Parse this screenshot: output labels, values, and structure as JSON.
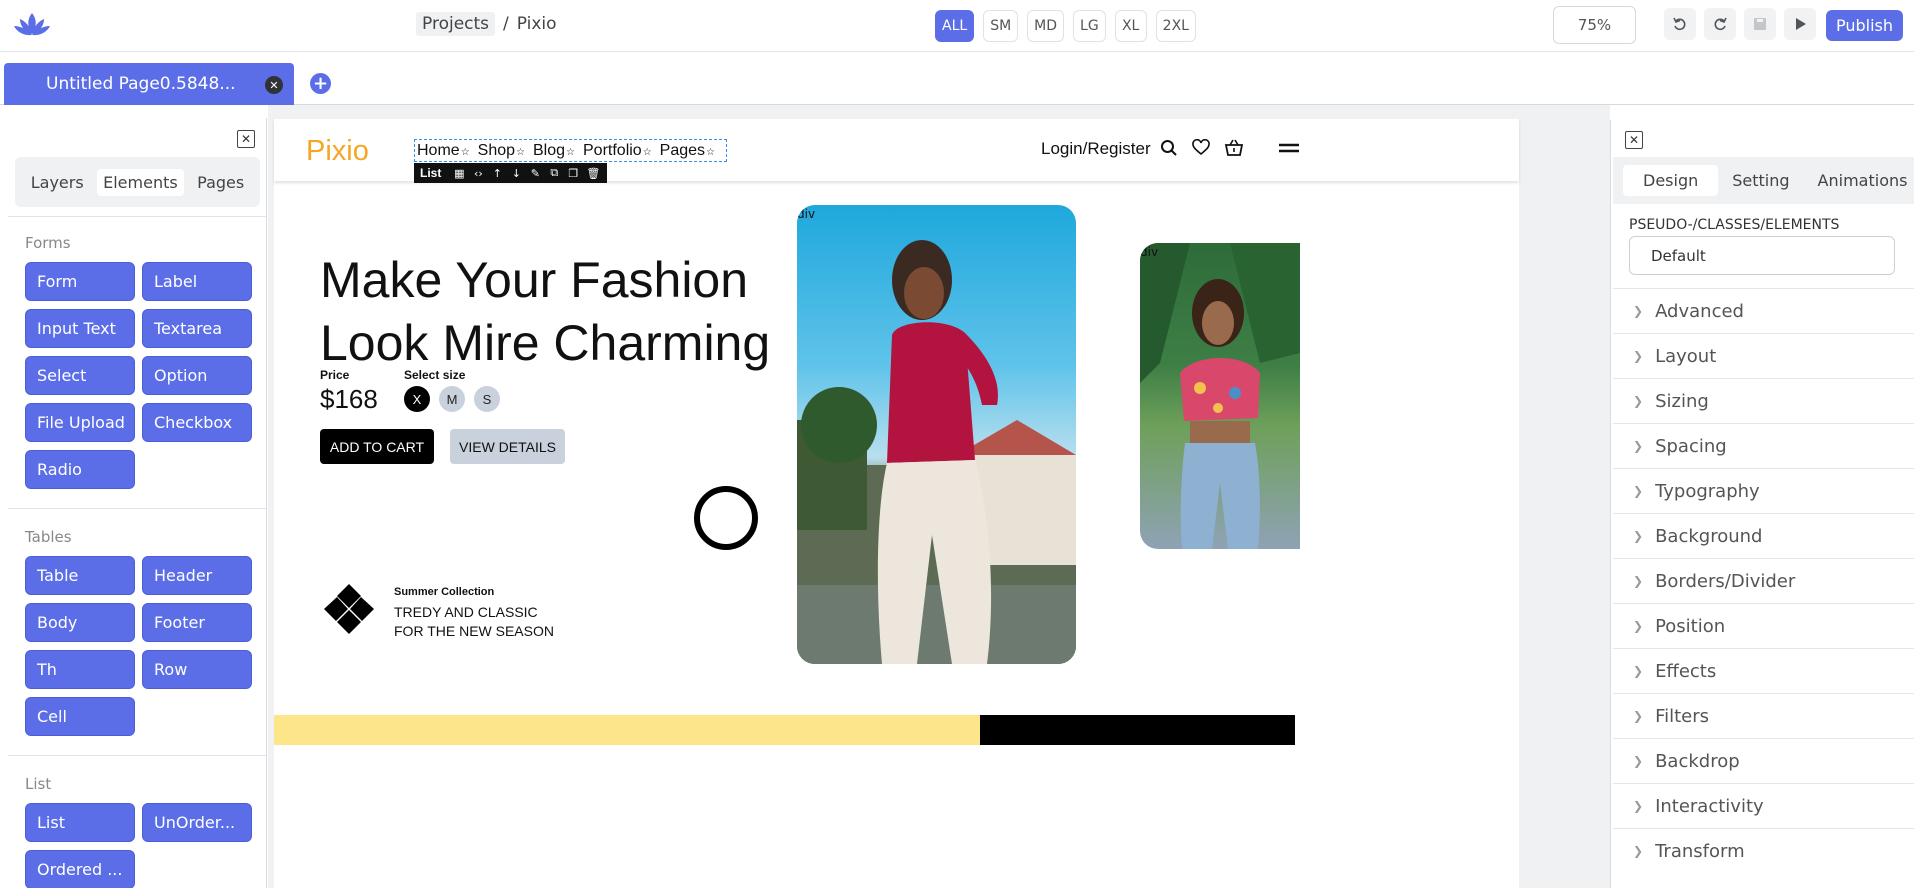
{
  "header": {
    "breadcrumb_projects": "Projects",
    "breadcrumb_sep": "/",
    "breadcrumb_current": "Pixio",
    "breakpoints": [
      "ALL",
      "SM",
      "MD",
      "LG",
      "XL",
      "2XL"
    ],
    "zoom": "75%",
    "publish_label": "Publish"
  },
  "tabs": {
    "page_tab_label": "Untitled Page0.5848..."
  },
  "left_panel": {
    "tabs": [
      "Layers",
      "Elements",
      "Pages"
    ],
    "sections": [
      {
        "title": "Forms",
        "items": [
          "Form",
          "Label",
          "Input Text",
          "Textarea",
          "Select",
          "Option",
          "File Upload",
          "Checkbox",
          "Radio"
        ]
      },
      {
        "title": "Tables",
        "items": [
          "Table",
          "Header",
          "Body",
          "Footer",
          "Th",
          "Row",
          "Cell"
        ]
      },
      {
        "title": "List",
        "items": [
          "List",
          "UnOrder...",
          "Ordered ..."
        ]
      }
    ]
  },
  "site": {
    "brand": "Pixio",
    "nav_items": [
      "Home",
      "Shop",
      "Blog",
      "Portfolio",
      "Pages"
    ],
    "selection_label": "List",
    "login": "Login/Register",
    "hero_title": "Make Your Fashion Look Mire Charming",
    "price_label": "Price",
    "price": "$168",
    "size_label": "Select size",
    "sizes": [
      "X",
      "M",
      "S"
    ],
    "add_to_cart": "ADD TO CART",
    "view_details": "VIEW DETAILS",
    "collection_title": "Summer Collection",
    "collection_sub": "TREDY AND CLASSIC FOR THE NEW SEASON",
    "div_label": "div",
    "div_label_2": "div"
  },
  "right_panel": {
    "tabs": [
      "Design",
      "Setting",
      "Animations"
    ],
    "pseudo_label": "PSEUDO-/CLASSES/ELEMENTS",
    "pseudo_value": "Default",
    "sections": [
      "Advanced",
      "Layout",
      "Sizing",
      "Spacing",
      "Typography",
      "Background",
      "Borders/Divider",
      "Position",
      "Effects",
      "Filters",
      "Backdrop",
      "Interactivity",
      "Transform"
    ]
  },
  "colors": {
    "accent": "#5b6ee8",
    "brand": "#f5a623",
    "band_yellow": "#fde68a"
  }
}
